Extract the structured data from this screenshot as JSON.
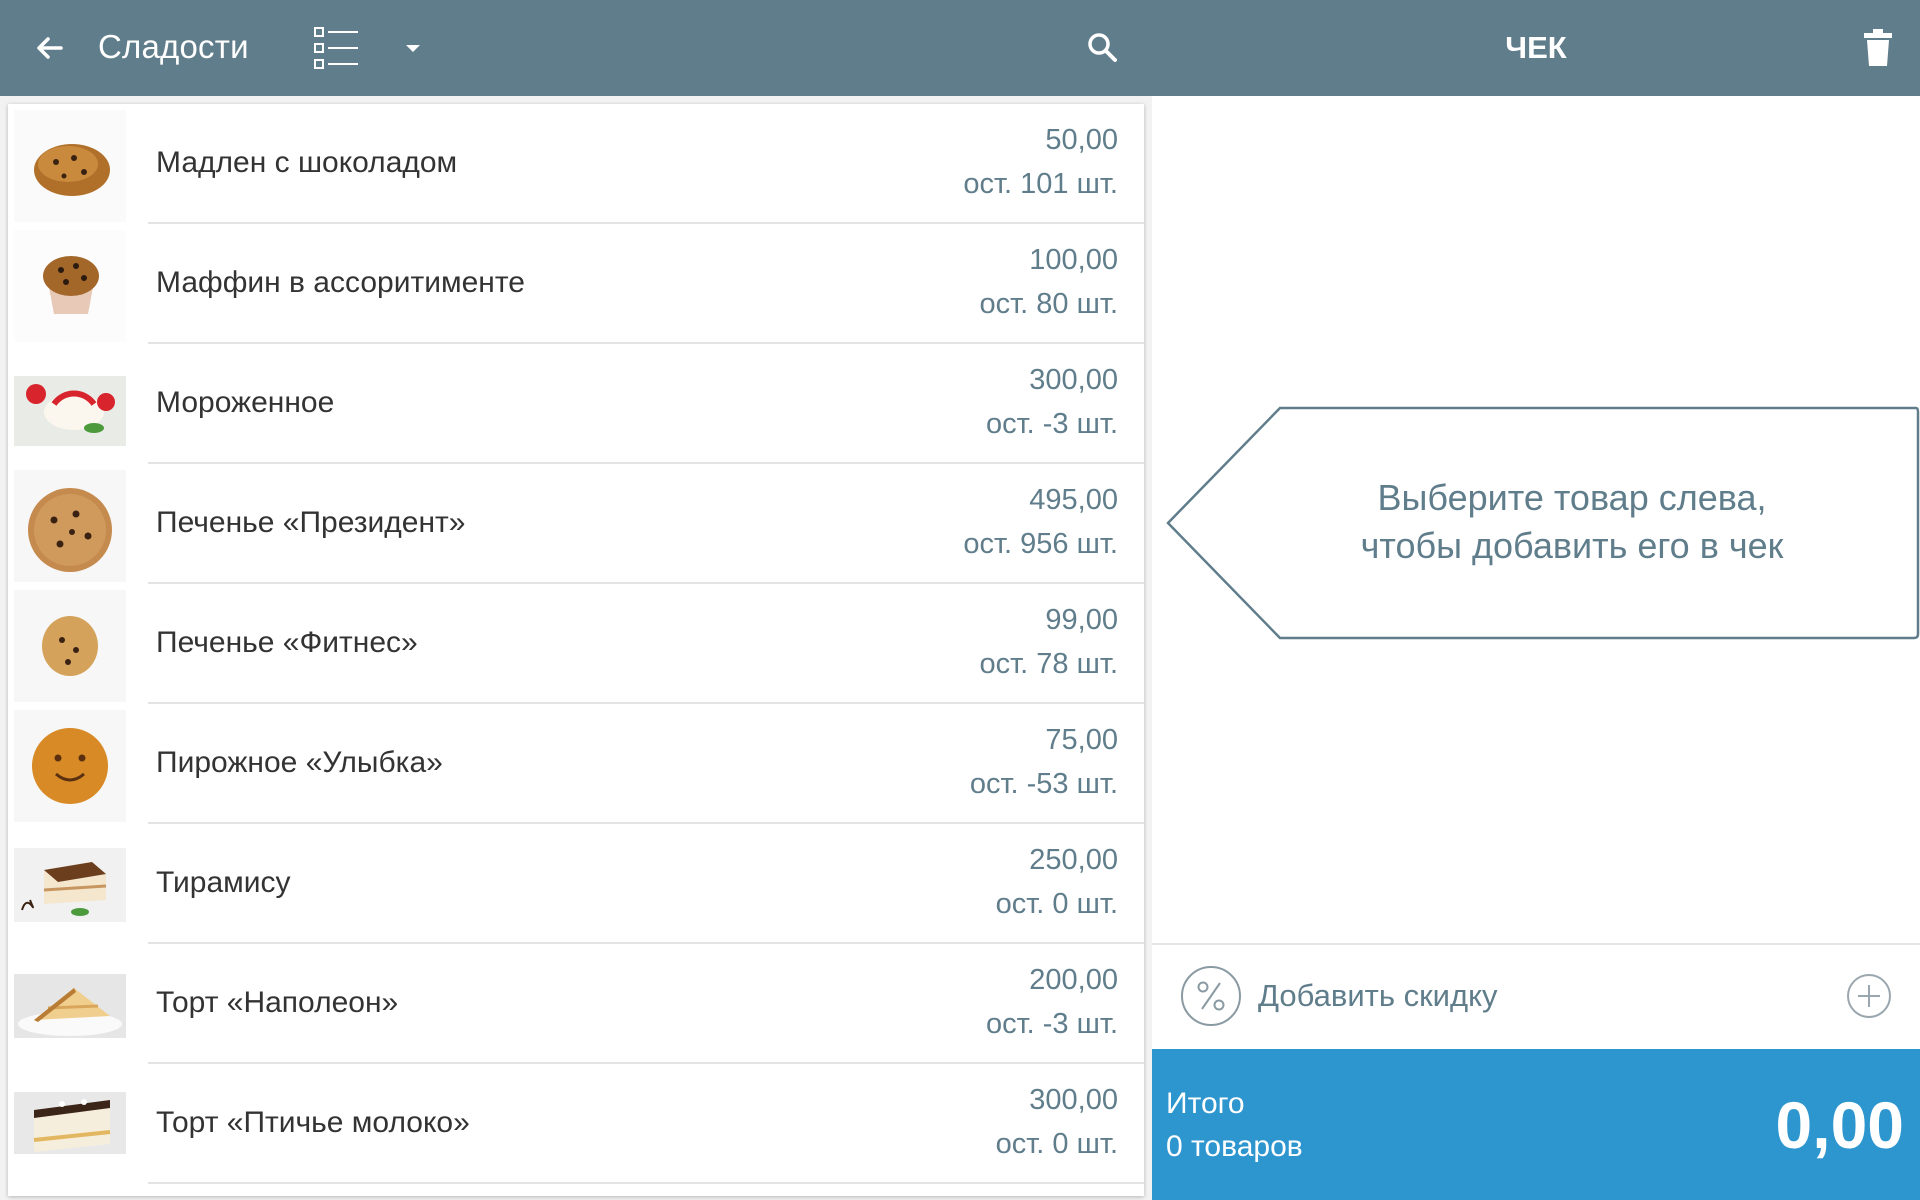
{
  "header": {
    "category_title": "Сладости",
    "receipt_title": "ЧЕК",
    "icons": {
      "back": "arrow-left-icon",
      "view": "list-view-icon",
      "dropdown": "caret-down-icon",
      "search": "search-icon",
      "trash": "trash-icon"
    }
  },
  "products": [
    {
      "name": "Мадлен с шоколадом",
      "price": "50,00",
      "stock": "ост. 101 шт.",
      "image": "madeleine-photo"
    },
    {
      "name": "Маффин в ассоритименте",
      "price": "100,00",
      "stock": "ост. 80 шт.",
      "image": "muffin-photo"
    },
    {
      "name": "Мороженное",
      "price": "300,00",
      "stock": "ост. -3 шт.",
      "image": "ice-cream-photo"
    },
    {
      "name": "Печенье «Президент»",
      "price": "495,00",
      "stock": "ост. 956 шт.",
      "image": "cookie-photo"
    },
    {
      "name": "Печенье «Фитнес»",
      "price": "99,00",
      "stock": "ост. 78 шт.",
      "image": "fitness-cookie-photo"
    },
    {
      "name": "Пирожное «Улыбка»",
      "price": "75,00",
      "stock": "ост. -53 шт.",
      "image": "smile-cake-photo"
    },
    {
      "name": "Тирамису",
      "price": "250,00",
      "stock": "ост. 0 шт.",
      "image": "tiramisu-photo"
    },
    {
      "name": "Торт «Наполеон»",
      "price": "200,00",
      "stock": "ост. -3 шт.",
      "image": "napoleon-cake-photo"
    },
    {
      "name": "Торт «Птичье молоко»",
      "price": "300,00",
      "stock": "ост. 0 шт.",
      "image": "bird-milk-cake-photo"
    }
  ],
  "receipt": {
    "hint_line1": "Выберите товар слева,",
    "hint_line2": "чтобы добавить его в чек",
    "discount_label": "Добавить скидку",
    "total_label": "Итого",
    "items_count": "0 товаров",
    "total_amount": "0,00"
  },
  "colors": {
    "header": "#607d8b",
    "accent_text": "#607d8b",
    "total_bar": "#2e96cf"
  }
}
